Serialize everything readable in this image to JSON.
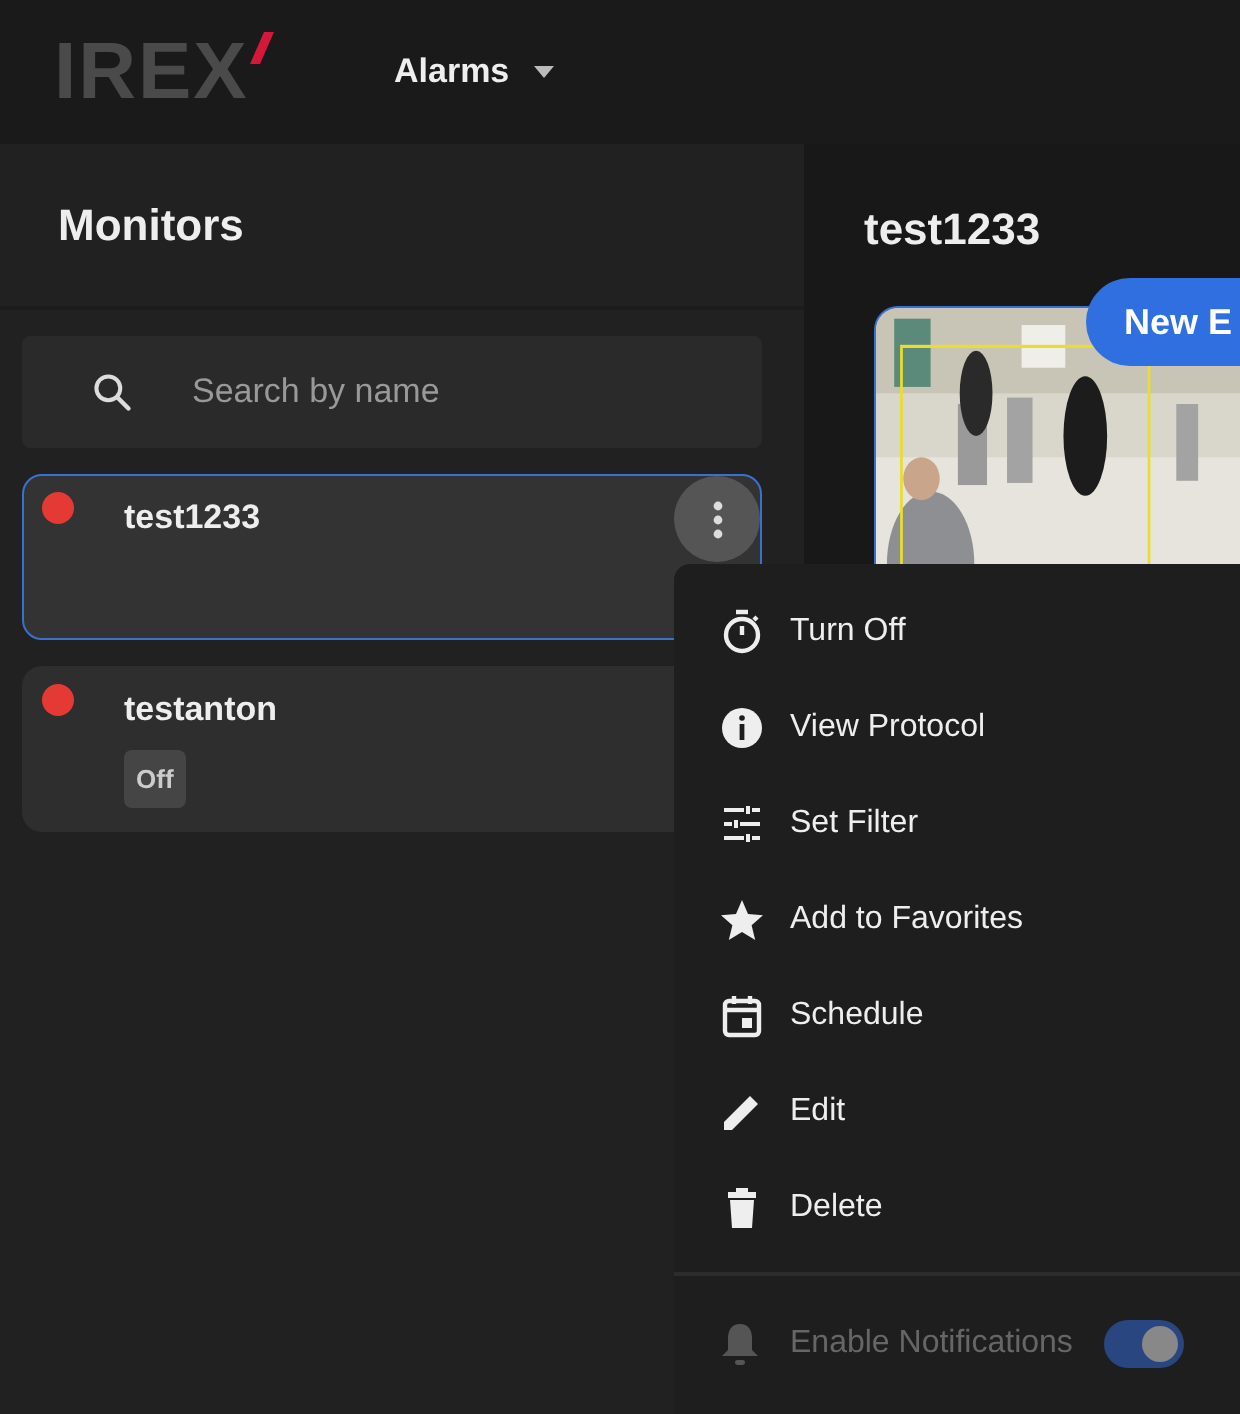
{
  "header": {
    "logo": "IREX",
    "nav": {
      "label": "Alarms"
    }
  },
  "sidebar": {
    "title": "Monitors",
    "search": {
      "placeholder": "Search by name"
    },
    "monitors": [
      {
        "name": "test1233",
        "color": "#e53935",
        "selected": true,
        "menu_open": true
      },
      {
        "name": "testanton",
        "color": "#e53935",
        "selected": false,
        "badge": "Off"
      }
    ]
  },
  "detail": {
    "title": "test1233",
    "new_events": "New E"
  },
  "context_menu": {
    "items": [
      {
        "label": "Turn Off"
      },
      {
        "label": "View Protocol"
      },
      {
        "label": "Set Filter"
      },
      {
        "label": "Add to Favorites"
      },
      {
        "label": "Schedule"
      },
      {
        "label": "Edit"
      },
      {
        "label": "Delete"
      }
    ],
    "notifications": {
      "label": "Enable Notifications",
      "disabled": true,
      "on": true
    }
  }
}
